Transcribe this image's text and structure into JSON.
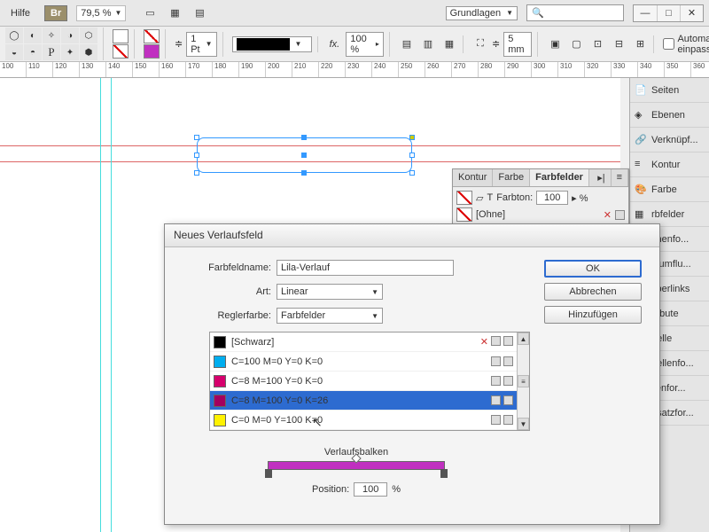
{
  "menu": {
    "help": "Hilfe",
    "br": "Br",
    "zoom": "79,5 %",
    "workspace": "Grundlagen"
  },
  "toolbar": {
    "stroke_weight": "1 Pt",
    "stroke_pct": "100 %",
    "frame_size": "5 mm",
    "autofit": "Automatisch einpassen"
  },
  "ruler_ticks": [
    "100",
    "110",
    "120",
    "130",
    "140",
    "150",
    "160",
    "170",
    "180",
    "190",
    "200",
    "210",
    "220",
    "230",
    "240",
    "250",
    "260",
    "270",
    "280",
    "290",
    "300",
    "310",
    "320",
    "330",
    "340",
    "350",
    "360"
  ],
  "dialog": {
    "title": "Neues Verlaufsfeld",
    "name_lbl": "Farbfeldname:",
    "name_val": "Lila-Verlauf",
    "type_lbl": "Art:",
    "type_val": "Linear",
    "stopcolor_lbl": "Reglerfarbe:",
    "stopcolor_val": "Farbfelder",
    "ok": "OK",
    "cancel": "Abbrechen",
    "add": "Hinzufügen",
    "ramp_lbl": "Verlaufsbalken",
    "pos_lbl": "Position:",
    "pos_val": "100",
    "pos_unit": "%"
  },
  "swatches": [
    {
      "name": "[Schwarz]",
      "color": "#000",
      "sel": false,
      "lock": true
    },
    {
      "name": "C=100 M=0 Y=0 K=0",
      "color": "#00aeef",
      "sel": false,
      "lock": false
    },
    {
      "name": "C=8 M=100 Y=0 K=0",
      "color": "#d6006d",
      "sel": false,
      "lock": false
    },
    {
      "name": "C=8 M=100 Y=0 K=26",
      "color": "#a3005e",
      "sel": true,
      "lock": false
    },
    {
      "name": "C=0 M=0 Y=100 K=0",
      "color": "#fff200",
      "sel": false,
      "lock": false
    }
  ],
  "float": {
    "tabs": [
      "Kontur",
      "Farbe",
      "Farbfelder"
    ],
    "tint_lbl": "Farbton:",
    "tint_val": "100",
    "none_lbl": "[Ohne]"
  },
  "rightPanels": [
    "Seiten",
    "Ebenen",
    "Verknüpf...",
    "Kontur",
    "Farbe",
    "rbfelder",
    "chenfo...",
    "xtumflu...",
    "yperlinks",
    "tribute",
    "belle",
    "bellenfo...",
    "llenfor...",
    "bsatzfor..."
  ]
}
